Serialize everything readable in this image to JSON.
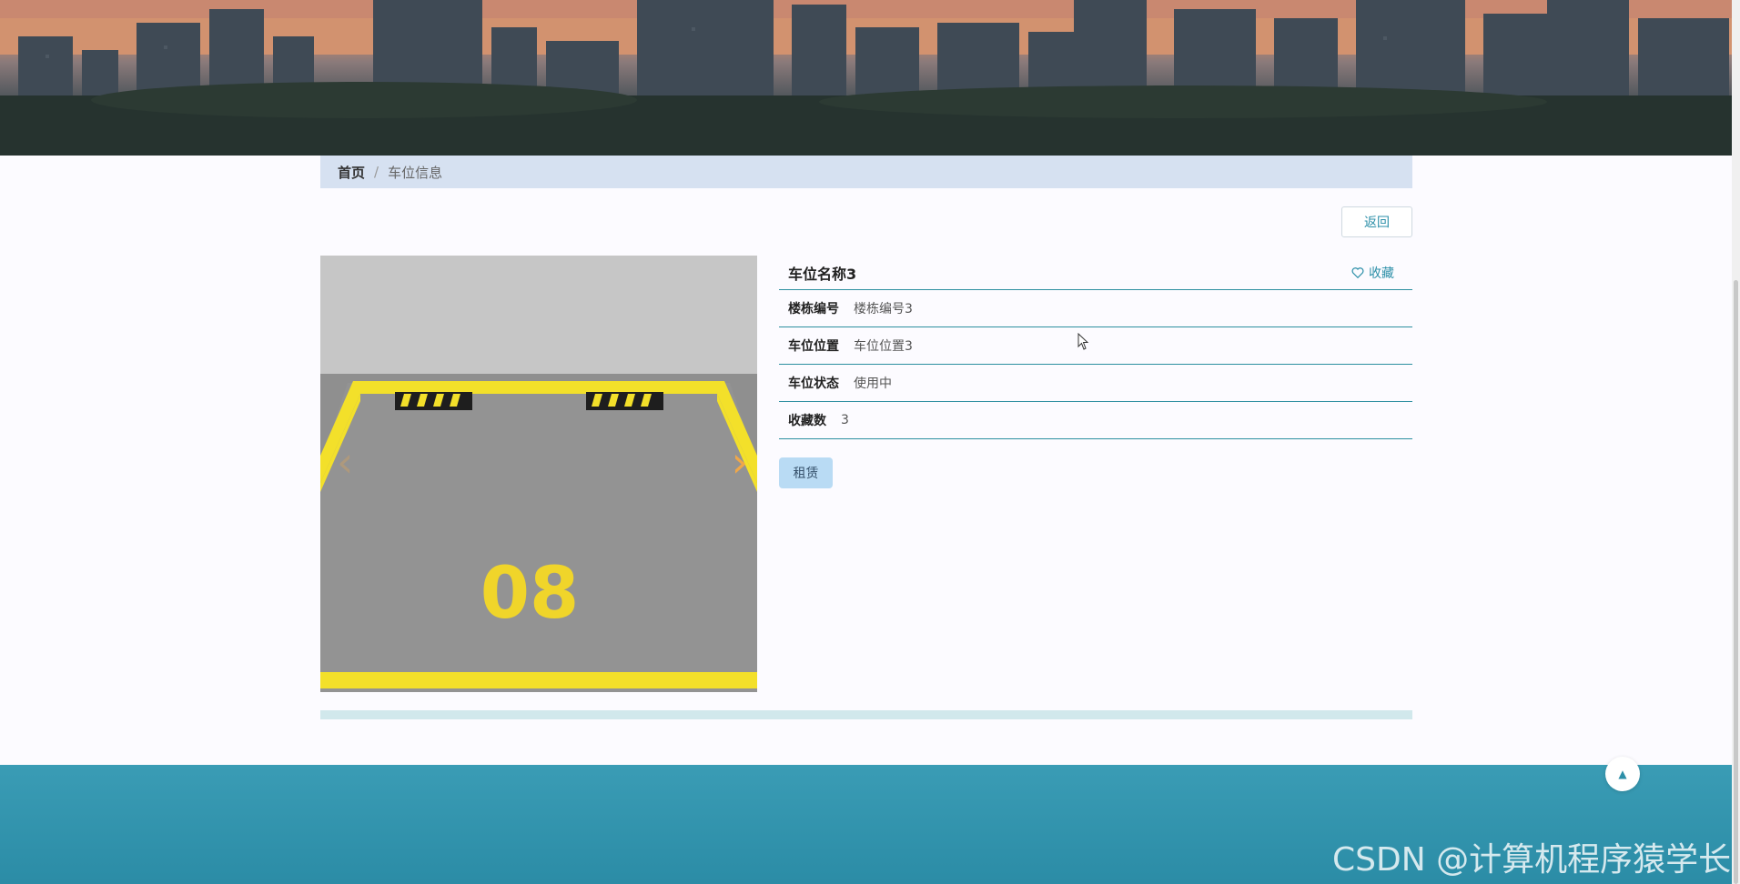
{
  "breadcrumb": {
    "home": "首页",
    "separator": "/",
    "current": "车位信息"
  },
  "actions": {
    "back_label": "返回",
    "favorite_label": "收藏",
    "rent_label": "租赁"
  },
  "detail": {
    "title": "车位名称3",
    "rows": [
      {
        "label": "楼栋编号",
        "value": "楼栋编号3"
      },
      {
        "label": "车位位置",
        "value": "车位位置3"
      },
      {
        "label": "车位状态",
        "value": "使用中"
      },
      {
        "label": "收藏数",
        "value": "3"
      }
    ]
  },
  "carousel": {
    "parking_number": "08",
    "prev_icon": "chevron-left-icon",
    "next_icon": "chevron-right-icon"
  },
  "watermark": "CSDN @计算机程序猿学长",
  "colors": {
    "accent": "#2c8fa8",
    "footer": "#3a9cb5",
    "breadcrumb_bg": "#d6e1f1",
    "rent_bg": "#b9dbf4"
  }
}
